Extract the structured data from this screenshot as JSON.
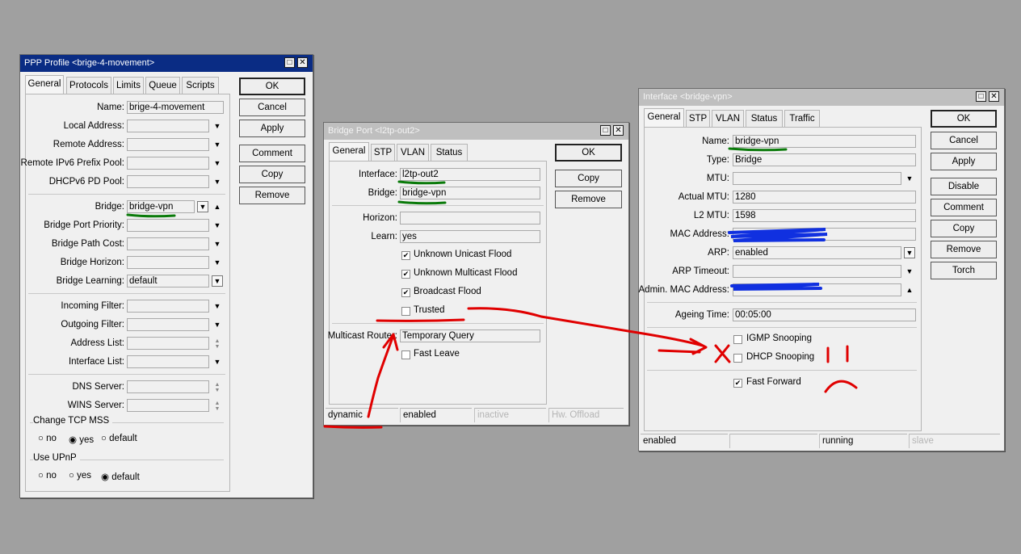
{
  "ppp_window": {
    "title": "PPP Profile <brige-4-movement>",
    "tabs": [
      "General",
      "Protocols",
      "Limits",
      "Queue",
      "Scripts"
    ],
    "buttons": [
      "OK",
      "Cancel",
      "Apply",
      "Comment",
      "Copy",
      "Remove"
    ],
    "fields": {
      "name": {
        "label": "Name:",
        "value": "brige-4-movement"
      },
      "local_address": {
        "label": "Local Address:",
        "value": ""
      },
      "remote_address": {
        "label": "Remote Address:",
        "value": ""
      },
      "remote_ipv6_prefix_pool": {
        "label": "Remote IPv6 Prefix Pool:",
        "value": ""
      },
      "dhcpv6_pd_pool": {
        "label": "DHCPv6 PD Pool:",
        "value": ""
      },
      "bridge": {
        "label": "Bridge:",
        "value": "bridge-vpn"
      },
      "bridge_port_priority": {
        "label": "Bridge Port Priority:",
        "value": ""
      },
      "bridge_path_cost": {
        "label": "Bridge Path Cost:",
        "value": ""
      },
      "bridge_horizon": {
        "label": "Bridge Horizon:",
        "value": ""
      },
      "bridge_learning": {
        "label": "Bridge Learning:",
        "value": "default"
      },
      "incoming_filter": {
        "label": "Incoming Filter:",
        "value": ""
      },
      "outgoing_filter": {
        "label": "Outgoing Filter:",
        "value": ""
      },
      "address_list": {
        "label": "Address List:",
        "value": ""
      },
      "interface_list": {
        "label": "Interface List:",
        "value": ""
      },
      "dns_server": {
        "label": "DNS Server:",
        "value": ""
      },
      "wins_server": {
        "label": "WINS Server:",
        "value": ""
      }
    },
    "change_tcp_mss": {
      "label": "Change TCP MSS",
      "options": [
        "no",
        "yes",
        "default"
      ],
      "selected": "yes"
    },
    "use_upnp": {
      "label": "Use UPnP",
      "options": [
        "no",
        "yes",
        "default"
      ],
      "selected": "default"
    }
  },
  "bridge_port_window": {
    "title": "Bridge Port <l2tp-out2>",
    "tabs": [
      "General",
      "STP",
      "VLAN",
      "Status"
    ],
    "buttons": [
      "OK",
      "Copy",
      "Remove"
    ],
    "fields": {
      "interface": {
        "label": "Interface:",
        "value": "l2tp-out2"
      },
      "bridge": {
        "label": "Bridge:",
        "value": "bridge-vpn"
      },
      "horizon": {
        "label": "Horizon:",
        "value": ""
      },
      "learn": {
        "label": "Learn:",
        "value": "yes"
      },
      "multicast_router": {
        "label": "Multicast Router:",
        "value": "Temporary Query"
      }
    },
    "checkboxes": [
      {
        "label": "Unknown Unicast Flood",
        "checked": true
      },
      {
        "label": "Unknown Multicast Flood",
        "checked": true
      },
      {
        "label": "Broadcast Flood",
        "checked": true
      },
      {
        "label": "Trusted",
        "checked": false
      }
    ],
    "fast_leave": {
      "label": "Fast Leave",
      "checked": false
    },
    "status": [
      "dynamic",
      "enabled",
      "inactive",
      "Hw. Offload"
    ]
  },
  "interface_window": {
    "title": "Interface <bridge-vpn>",
    "tabs": [
      "General",
      "STP",
      "VLAN",
      "Status",
      "Traffic"
    ],
    "buttons": [
      "OK",
      "Cancel",
      "Apply",
      "Disable",
      "Comment",
      "Copy",
      "Remove",
      "Torch"
    ],
    "fields": {
      "name": {
        "label": "Name:",
        "value": "bridge-vpn"
      },
      "type": {
        "label": "Type:",
        "value": "Bridge"
      },
      "mtu": {
        "label": "MTU:",
        "value": ""
      },
      "actual_mtu": {
        "label": "Actual MTU:",
        "value": "1280"
      },
      "l2_mtu": {
        "label": "L2 MTU:",
        "value": "1598"
      },
      "mac_address": {
        "label": "MAC Address:",
        "value": ""
      },
      "arp": {
        "label": "ARP:",
        "value": "enabled"
      },
      "arp_timeout": {
        "label": "ARP Timeout:",
        "value": ""
      },
      "admin_mac_address": {
        "label": "Admin. MAC Address:",
        "value": ""
      },
      "ageing_time": {
        "label": "Ageing Time:",
        "value": "00:05:00"
      }
    },
    "checkboxes": [
      {
        "label": "IGMP Snooping",
        "checked": false
      },
      {
        "label": "DHCP Snooping",
        "checked": false
      }
    ],
    "fast_forward": {
      "label": "Fast Forward",
      "checked": true
    },
    "status": [
      "enabled",
      "",
      "running",
      "slave"
    ]
  },
  "colors": {
    "annotation_red": "#e00000",
    "annotation_green": "#0a7a0a",
    "scribble_blue": "#1030e0",
    "title_active": "#0a2c84"
  }
}
